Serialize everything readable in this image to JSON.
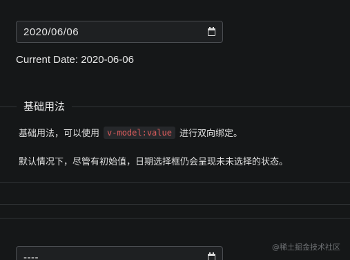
{
  "date_picker_top": {
    "value": "2020/06/06"
  },
  "current_date": {
    "text": "Current Date: 2020-06-06"
  },
  "section": {
    "title": "基础用法"
  },
  "description": {
    "line1_before": "基础用法，可以使用",
    "line1_code": "v-model:value",
    "line1_after": "进行双向绑定。",
    "line2": "默认情况下，尽管有初始值，日期选择框仍会呈现未未选择的状态。"
  },
  "date_picker_bottom": {
    "value": "----"
  },
  "watermark": {
    "text": "@稀土掘金技术社区"
  },
  "icons": {
    "calendar": "calendar-icon"
  },
  "colors": {
    "background": "#151718",
    "code_text": "#e05e5e",
    "border": "#4a4d51"
  }
}
